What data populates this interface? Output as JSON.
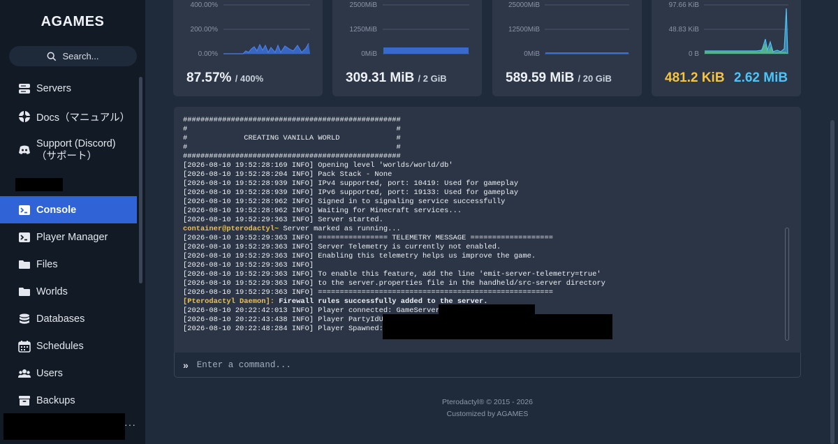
{
  "brand": {
    "logo": "AGAMES"
  },
  "search": {
    "label": "Search..."
  },
  "nav": {
    "items": [
      {
        "label": "Servers",
        "icon": "servers-icon"
      },
      {
        "label": "Docs（マニュアル）",
        "icon": "docs-icon"
      },
      {
        "label_line1": "Support (Discord)",
        "label_line2": "（サポート）",
        "icon": "discord-icon"
      },
      {
        "label": "Console",
        "icon": "console-icon",
        "active": true
      },
      {
        "label": "Player Manager",
        "icon": "player-manager-icon"
      },
      {
        "label": "Files",
        "icon": "folder-icon"
      },
      {
        "label": "Worlds",
        "icon": "folder-icon"
      },
      {
        "label": "Databases",
        "icon": "database-icon"
      },
      {
        "label": "Schedules",
        "icon": "calendar-icon"
      },
      {
        "label": "Users",
        "icon": "users-icon"
      },
      {
        "label": "Backups",
        "icon": "archive-icon"
      }
    ],
    "more": "···"
  },
  "stats": {
    "cpu": {
      "value": "87.57%",
      "limit": "/ 400%",
      "ticks": [
        "400.00%",
        "200.00%",
        "0.00%"
      ]
    },
    "memory": {
      "value": "309.31 MiB",
      "limit": "/ 2 GiB",
      "ticks": [
        "2500MiB",
        "1250MiB",
        "0MiB"
      ]
    },
    "disk": {
      "value": "589.59 MiB",
      "limit": "/ 20 GiB",
      "ticks": [
        "25000MiB",
        "12500MiB",
        "0MiB"
      ]
    },
    "network": {
      "inbound": "481.2 KiB",
      "outbound": "2.62 MiB",
      "ticks": [
        "97.66 KiB",
        "48.83 KiB",
        "0 B"
      ]
    }
  },
  "colors": {
    "accent": "#2f63d6",
    "chart_line": "#3b6fd8",
    "inbound": "#f5c542",
    "outbound": "#4fc3f7",
    "prompt": "#f0c14b"
  },
  "console": {
    "lines": [
      {
        "text": "##################################################"
      },
      {
        "text": "#                                                #"
      },
      {
        "text": "#             CREATING VANILLA WORLD             #"
      },
      {
        "text": "#                                                #"
      },
      {
        "text": "##################################################"
      },
      {
        "text": "[2026-08-10 19:52:28:169 INFO] Opening level 'worlds/world/db'"
      },
      {
        "text": "[2026-08-10 19:52:28:204 INFO] Pack Stack - None"
      },
      {
        "text": "[2026-08-10 19:52:28:939 INFO] IPv4 supported, port: 10419: Used for gameplay"
      },
      {
        "text": "[2026-08-10 19:52:28:939 INFO] IPv6 supported, port: 19133: Used for gameplay"
      },
      {
        "text": "[2026-08-10 19:52:28:962 INFO] Signed in to signaling service successfully"
      },
      {
        "text": "[2026-08-10 19:52:28:962 INFO] Waiting for Minecraft services..."
      },
      {
        "text": "[2026-08-10 19:52:29:363 INFO] Server started."
      },
      {
        "prefix": "container@pterodactyl~",
        "text": " Server marked as running..."
      },
      {
        "text": "[2026-08-10 19:52:29:363 INFO] ================ TELEMETRY MESSAGE ==================="
      },
      {
        "text": "[2026-08-10 19:52:29:363 INFO] Server Telemetry is currently not enabled."
      },
      {
        "text": "[2026-08-10 19:52:29:363 INFO] Enabling this telemetry helps us improve the game."
      },
      {
        "text": "[2026-08-10 19:52:29:363 INFO]"
      },
      {
        "text": "[2026-08-10 19:52:29:363 INFO] To enable this feature, add the line 'emit-server-telemetry=true'"
      },
      {
        "text": "[2026-08-10 19:52:29:363 INFO] to the server.properties file in the handheld/src-server directory"
      },
      {
        "text": "[2026-08-10 19:52:29:363 INFO] ======================================================"
      },
      {
        "prefix": "[Pterodactyl Daemon]:",
        "text": " Firewall rules successfully added to the server.",
        "bold": true
      },
      {
        "text": "[2026-08-10 20:22:42:013 INFO] Player connected: GameServerLab, x"
      },
      {
        "text": "[2026-08-10 20:22:43:438 INFO] Player PartyIdUpdat"
      },
      {
        "text": "[2026-08-10 20:22:48:284 INFO] Player Spawned: Gam"
      }
    ],
    "placeholder": "Enter a command..."
  },
  "footer": {
    "line1": "Pterodactyl® © 2015 - 2026",
    "line2": "Customized by AGAMES"
  }
}
